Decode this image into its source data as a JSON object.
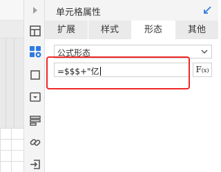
{
  "panel": {
    "title": "单元格属性",
    "tabs": [
      {
        "label": "扩展",
        "active": false
      },
      {
        "label": "样式",
        "active": false
      },
      {
        "label": "形态",
        "active": true
      },
      {
        "label": "其他",
        "active": false
      }
    ]
  },
  "form": {
    "shape_select_value": "公式形态",
    "formula_value": "=$$$+\"亿",
    "fx_label": "F",
    "fx_sub": "(x)"
  },
  "icons": {
    "left_collapse": "chevron-right-icon",
    "expand": "expand-icon",
    "tools": [
      "table-icon",
      "cell-element-icon",
      "border-icon",
      "dropdown-widget-icon",
      "condition-attribute-icon",
      "hyperlink-icon",
      "import-icon"
    ],
    "pin": "pin-icon"
  },
  "colors": {
    "highlight": "#ee2626",
    "active_icon": "#2e7be0",
    "panel_header": "#f4f4f4"
  }
}
